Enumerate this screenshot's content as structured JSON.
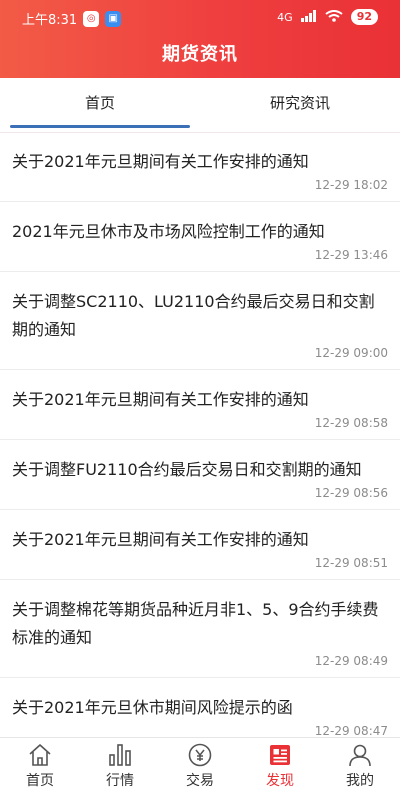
{
  "status_bar": {
    "time": "上午8:31",
    "network": "4G",
    "battery": "92"
  },
  "header": {
    "title": "期货资讯"
  },
  "tabs": [
    {
      "label": "首页"
    },
    {
      "label": "研究资讯"
    }
  ],
  "news": [
    {
      "title": "关于2021年元旦期间有关工作安排的通知",
      "time": "12-29 18:02"
    },
    {
      "title": "2021年元旦休市及市场风险控制工作的通知",
      "time": "12-29 13:46"
    },
    {
      "title": "关于调整SC2110、LU2110合约最后交易日和交割期的通知",
      "time": "12-29 09:00"
    },
    {
      "title": "关于2021年元旦期间有关工作安排的通知",
      "time": "12-29 08:58"
    },
    {
      "title": "关于调整FU2110合约最后交易日和交割期的通知",
      "time": "12-29 08:56"
    },
    {
      "title": "关于2021年元旦期间有关工作安排的通知",
      "time": "12-29 08:51"
    },
    {
      "title": "关于调整棉花等期货品种近月非1、5、9合约手续费标准的通知",
      "time": "12-29 08:49"
    },
    {
      "title": "关于2021年元旦休市期间风险提示的函",
      "time": "12-29 08:47"
    }
  ],
  "bottom_nav": [
    {
      "label": "首页",
      "icon": "home-icon"
    },
    {
      "label": "行情",
      "icon": "market-chart-icon"
    },
    {
      "label": "交易",
      "icon": "yen-coin-icon"
    },
    {
      "label": "发现",
      "icon": "discover-news-icon"
    },
    {
      "label": "我的",
      "icon": "profile-icon"
    }
  ],
  "colors": {
    "header_start": "#f25b46",
    "header_end": "#e93136",
    "active_red": "#e93136",
    "tab_underline": "#3b6fb6",
    "timestamp": "#8c8c8c"
  }
}
